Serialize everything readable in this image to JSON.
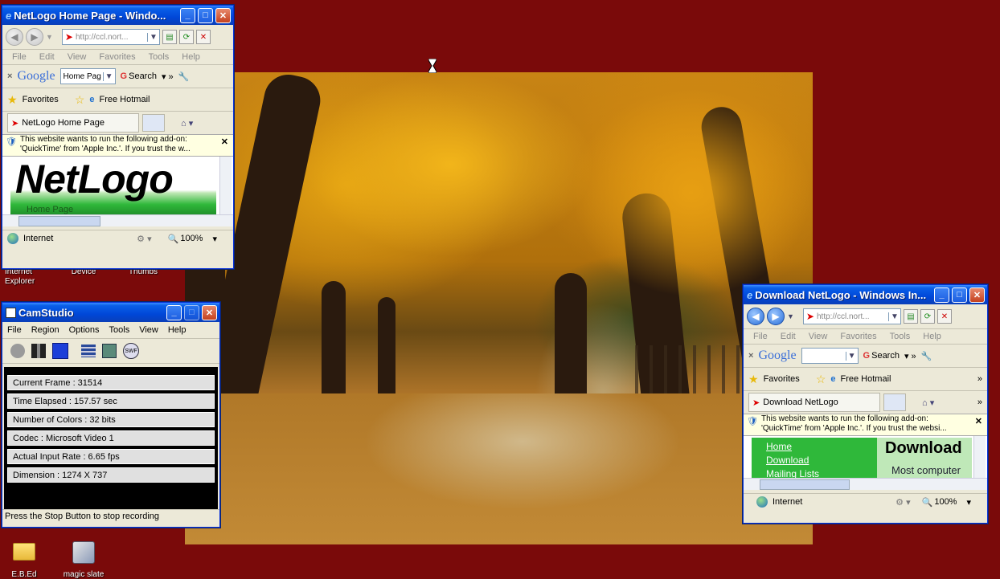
{
  "colors": {
    "desktop": "#7a0a0a",
    "xp_title": "#0047d8",
    "netlogo_green": "#2fb83a"
  },
  "desktop": {
    "top_icon_labels": [
      {
        "label": "Internet\nExplorer"
      },
      {
        "label": "Device"
      },
      {
        "label": "Thumbs"
      }
    ],
    "bottom_icons": [
      {
        "label": "E.B.Ed",
        "icon": "folder-icon"
      },
      {
        "label": "magic slate",
        "icon": "application-icon"
      }
    ]
  },
  "ie_left": {
    "title": "NetLogo Home Page - Windo...",
    "address": "http://ccl.nort...",
    "menu": [
      "File",
      "Edit",
      "View",
      "Favorites",
      "Tools",
      "Help"
    ],
    "google": {
      "logo": "Google",
      "combo": "Home Pag",
      "search": "Search"
    },
    "favorites": "Favorites",
    "hotmail": "Free Hotmail",
    "tab": "NetLogo Home Page",
    "infobar": "This website wants to run the following add-on: 'QuickTime' from 'Apple Inc.'. If you trust the w...",
    "content": {
      "logo": "NetLogo",
      "sub": "Home Page"
    },
    "status": {
      "zone": "Internet",
      "zoom": "100%"
    }
  },
  "ie_right": {
    "title": "Download NetLogo - Windows In...",
    "address": "http://ccl.nort...",
    "menu": [
      "File",
      "Edit",
      "View",
      "Favorites",
      "Tools",
      "Help"
    ],
    "google": {
      "logo": "Google",
      "combo": "",
      "search": "Search"
    },
    "favorites": "Favorites",
    "hotmail": "Free Hotmail",
    "tab": "Download NetLogo",
    "infobar": "This website wants to run the following add-on: 'QuickTime' from 'Apple Inc.'. If you trust the websi...",
    "content": {
      "links": [
        "Home",
        "Download",
        "Mailing Lists"
      ],
      "heading": "Download",
      "sub": "Most computer"
    },
    "status": {
      "zone": "Internet",
      "zoom": "100%"
    }
  },
  "camstudio": {
    "title": "CamStudio",
    "menu": [
      "File",
      "Region",
      "Options",
      "Tools",
      "View",
      "Help"
    ],
    "info": [
      "Current Frame : 31514",
      "Time Elapsed : 157.57 sec",
      "Number of Colors : 32 bits",
      "Codec : Microsoft Video 1",
      "Actual Input Rate : 6.65 fps",
      "Dimension : 1274 X 737"
    ],
    "status": "Press the Stop Button to stop recording"
  }
}
